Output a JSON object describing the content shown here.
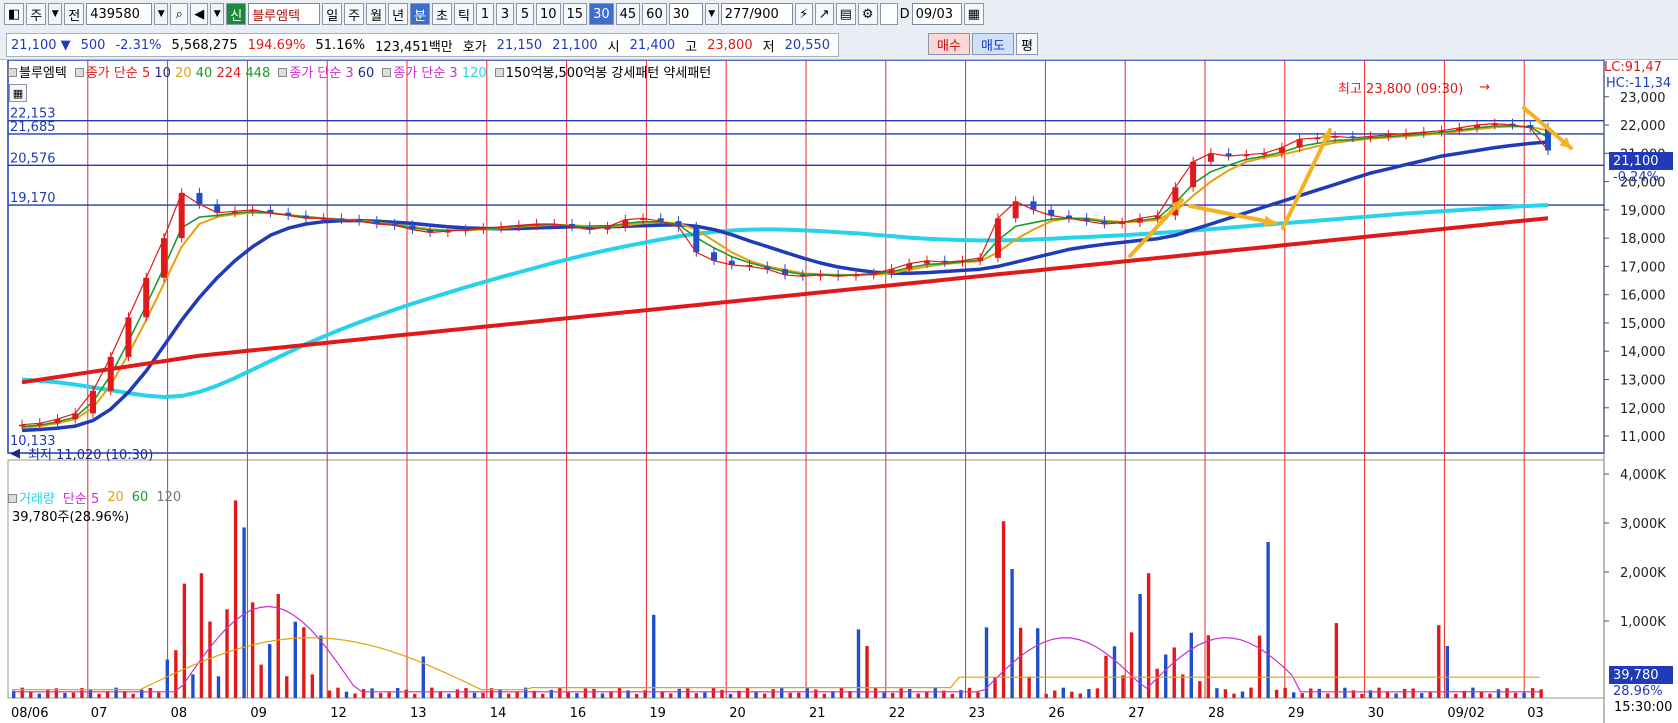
{
  "toolbar": {
    "period_type": "주",
    "prev_label": "전",
    "code": "439580",
    "new_badge": "신",
    "stock_name": "블루엠텍",
    "period_buttons": [
      "일",
      "주",
      "월",
      "년",
      "분",
      "초",
      "틱"
    ],
    "minute_options": [
      "1",
      "3",
      "5",
      "10",
      "15",
      "30",
      "45",
      "60"
    ],
    "interval_value": "30",
    "count_value": "277",
    "count_total": "/900",
    "d_label": "D",
    "date_value": "09/03"
  },
  "quote": {
    "price": "21,100",
    "arrow": "▼",
    "change": "500",
    "change_pct": "-2.31%",
    "volume": "5,568,275",
    "volume_ratio": "194.69%",
    "turnover_ratio": "51.16%",
    "amount": "123,451백만",
    "hoga_label": "호가",
    "ask": "21,150",
    "bid": "21,100",
    "open_label": "시",
    "open": "21,400",
    "high_label": "고",
    "high": "23,800",
    "low_label": "저",
    "low": "20,550",
    "buy_label": "매수",
    "sell_label": "매도",
    "eval_label": "평"
  },
  "price_legend": {
    "name": "블루엠텍",
    "ma1_title": "종가 단순 5",
    "ma1_periods": [
      "10",
      "20",
      "40",
      "224",
      "448"
    ],
    "ma2_title": "종가 단순 3",
    "ma2_period": "60",
    "ma3_title": "종가 단순 3",
    "ma3_period": "120",
    "pattern1": "150억봉,500억봉",
    "pattern2": "강세패턴",
    "pattern3": "약세패턴"
  },
  "volume_legend": {
    "name": "거래량",
    "title": "단순 5",
    "periods": [
      "20",
      "60",
      "120"
    ],
    "last_value": "39,780주(28.96%)"
  },
  "annotations": {
    "high_text": "최고 23,800 (09:30)",
    "low_text": "최저 11,020 (10:30)",
    "lc": "LC:91,47",
    "hc": "HC:-11,34",
    "current_price": "21,100",
    "current_pct": "-0.24%",
    "vol_current": "39,780",
    "vol_pct": "28.96%",
    "time_label": "15:30:00"
  },
  "colors": {
    "up": "#e01a1a",
    "down": "#1f4fc9",
    "ma5": "#e01a1a",
    "ma10": "#1f3bb8",
    "ma20": "#e6a00a",
    "ma40": "#1c9a2b",
    "ma224": "#e01a1a",
    "ma448": "#1f3bb8",
    "ma_long": "#27d3e8",
    "arrow": "#f5b21e"
  },
  "chart_data": {
    "type": "line",
    "x": [
      "08/06",
      "07",
      "08",
      "09",
      "12",
      "13",
      "14",
      "16",
      "19",
      "20",
      "21",
      "22",
      "23",
      "26",
      "27",
      "28",
      "29",
      "30",
      "09/02",
      "03"
    ],
    "price_ticks": [
      "23,000",
      "22,000",
      "21,000",
      "20,000",
      "19,000",
      "18,000",
      "17,000",
      "16,000",
      "15,000",
      "14,000",
      "13,000",
      "12,000",
      "11,000"
    ],
    "ylim": [
      10400,
      24300
    ],
    "levels": [
      {
        "label": "22,153",
        "value": 22153
      },
      {
        "label": "21,685",
        "value": 21685
      },
      {
        "label": "20,576",
        "value": 20576
      },
      {
        "label": "19,170",
        "value": 19170
      },
      {
        "label": "10,133",
        "value": 10133
      }
    ],
    "close": [
      11400,
      11450,
      11600,
      11800,
      12600,
      13800,
      15200,
      16600,
      18000,
      19600,
      19200,
      18900,
      18950,
      19000,
      18900,
      18800,
      18700,
      18700,
      18650,
      18600,
      18500,
      18450,
      18300,
      18200,
      18250,
      18300,
      18350,
      18400,
      18450,
      18500,
      18500,
      18400,
      18300,
      18400,
      18650,
      18700,
      18600,
      18400,
      17500,
      17200,
      17050,
      17000,
      16900,
      16700,
      16650,
      16700,
      16650,
      16700,
      16750,
      16900,
      17100,
      17200,
      17150,
      17200,
      17300,
      18700,
      19300,
      19000,
      18800,
      18700,
      18600,
      18500,
      18550,
      18700,
      18800,
      19800,
      20700,
      21000,
      20900,
      20950,
      21000,
      21200,
      21500,
      21550,
      21600,
      21550,
      21600,
      21650,
      21700,
      21750,
      21800,
      21900,
      22000,
      22050,
      22000,
      21900,
      21100
    ],
    "ma_short": [
      11300,
      11350,
      11450,
      11600,
      12000,
      12800,
      13900,
      15100,
      16400,
      17700,
      18500,
      18750,
      18850,
      18900,
      18880,
      18820,
      18760,
      18700,
      18660,
      18620,
      18560,
      18480,
      18400,
      18320,
      18280,
      18280,
      18310,
      18350,
      18400,
      18440,
      18470,
      18450,
      18420,
      18400,
      18450,
      18520,
      18560,
      18520,
      18300,
      17900,
      17500,
      17200,
      17000,
      16880,
      16760,
      16720,
      16700,
      16700,
      16710,
      16760,
      16880,
      17000,
      17080,
      17140,
      17180,
      17500,
      17950,
      18300,
      18600,
      18700,
      18700,
      18620,
      18570,
      18580,
      18650,
      18950,
      19500,
      20000,
      20400,
      20700,
      20850,
      20950,
      21100,
      21250,
      21380,
      21450,
      21520,
      21560,
      21600,
      21650,
      21700,
      21780,
      21850,
      21920,
      21950,
      21940,
      21800
    ],
    "ma_mid": [
      11200,
      11230,
      11280,
      11350,
      11550,
      11950,
      12550,
      13300,
      14200,
      15100,
      15900,
      16600,
      17200,
      17700,
      18100,
      18350,
      18500,
      18580,
      18620,
      18620,
      18600,
      18560,
      18520,
      18460,
      18400,
      18360,
      18340,
      18330,
      18340,
      18360,
      18380,
      18400,
      18400,
      18400,
      18420,
      18440,
      18460,
      18470,
      18420,
      18300,
      18120,
      17900,
      17700,
      17500,
      17300,
      17120,
      16980,
      16880,
      16800,
      16760,
      16760,
      16780,
      16820,
      16860,
      16900,
      17000,
      17150,
      17300,
      17450,
      17600,
      17700,
      17780,
      17850,
      17920,
      17980,
      18100,
      18300,
      18500,
      18700,
      18900,
      19100,
      19300,
      19500,
      19700,
      19900,
      20100,
      20300,
      20450,
      20600,
      20750,
      20900,
      21000,
      21100,
      21200,
      21280,
      21350,
      21400
    ],
    "ma_long": [
      13000,
      12950,
      12900,
      12820,
      12720,
      12620,
      12520,
      12430,
      12380,
      12420,
      12560,
      12780,
      13050,
      13350,
      13650,
      13950,
      14250,
      14520,
      14780,
      15020,
      15250,
      15470,
      15680,
      15880,
      16070,
      16260,
      16440,
      16620,
      16790,
      16960,
      17130,
      17290,
      17440,
      17580,
      17710,
      17830,
      17950,
      18060,
      18150,
      18220,
      18270,
      18300,
      18310,
      18300,
      18280,
      18250,
      18210,
      18170,
      18120,
      18070,
      18020,
      17980,
      17950,
      17930,
      17920,
      17920,
      17930,
      17950,
      17980,
      18010,
      18040,
      18070,
      18100,
      18140,
      18180,
      18220,
      18270,
      18320,
      18370,
      18420,
      18470,
      18520,
      18570,
      18620,
      18670,
      18720,
      18770,
      18820,
      18870,
      18910,
      18950,
      18990,
      19030,
      19070,
      19110,
      19140,
      19170
    ]
  },
  "volume_ticks": [
    "4,000K",
    "3,000K",
    "2,000K",
    "1,000K"
  ]
}
